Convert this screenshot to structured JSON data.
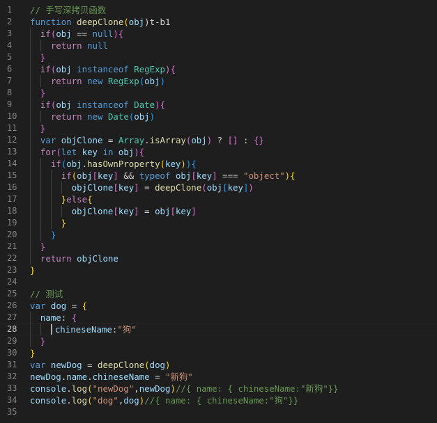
{
  "editor": {
    "language": "javascript",
    "theme_colors": {
      "background": "#1e1e1e",
      "line_number": "#858585",
      "comment": "#6a9955",
      "keyword": "#569cd6",
      "control": "#c586c0",
      "function": "#dcdcaa",
      "string": "#ce9178",
      "bracket_gold": "#ffd700",
      "bracket_orchid": "#da70d6",
      "bracket_blue": "#179fff"
    },
    "active_line": 28,
    "lines": [
      {
        "n": "1",
        "indent": 0,
        "tokens": [
          [
            "// 手写深拷贝函数",
            "t-comment"
          ]
        ]
      },
      {
        "n": "2",
        "indent": 0,
        "tokens": [
          [
            "function",
            "t-kw"
          ],
          [
            " ",
            "t-punc"
          ],
          [
            "deepClone",
            "t-fn"
          ],
          [
            "(",
            "t-b1"
          ],
          [
            "obj",
            "t-var"
          ],
          ")",
          "t-b1"
        ]
      },
      {
        "n": "3",
        "indent": 1,
        "tokens": [
          [
            "if",
            "t-ctrl"
          ],
          [
            "(",
            "t-b2"
          ],
          [
            "obj",
            "t-var"
          ],
          [
            " == ",
            "t-punc"
          ],
          [
            "null",
            "t-kw"
          ],
          [
            ")",
            "t-b2"
          ],
          [
            "{",
            "t-b2"
          ]
        ]
      },
      {
        "n": "4",
        "indent": 2,
        "tokens": [
          [
            "return",
            "t-ctrl"
          ],
          [
            " ",
            "t-punc"
          ],
          [
            "null",
            "t-kw"
          ]
        ]
      },
      {
        "n": "5",
        "indent": 1,
        "tokens": [
          [
            "}",
            "t-b2"
          ]
        ]
      },
      {
        "n": "6",
        "indent": 1,
        "tokens": [
          [
            "if",
            "t-ctrl"
          ],
          [
            "(",
            "t-b2"
          ],
          [
            "obj",
            "t-var"
          ],
          [
            " ",
            "t-punc"
          ],
          [
            "instanceof",
            "t-kw"
          ],
          [
            " ",
            "t-punc"
          ],
          [
            "RegExp",
            "t-cls"
          ],
          [
            ")",
            "t-b2"
          ],
          [
            "{",
            "t-b2"
          ]
        ]
      },
      {
        "n": "7",
        "indent": 2,
        "tokens": [
          [
            "return",
            "t-ctrl"
          ],
          [
            " ",
            "t-punc"
          ],
          [
            "new",
            "t-kw"
          ],
          [
            " ",
            "t-punc"
          ],
          [
            "RegExp",
            "t-cls"
          ],
          [
            "(",
            "t-b3"
          ],
          [
            "obj",
            "t-var"
          ],
          [
            ")",
            "t-b3"
          ]
        ]
      },
      {
        "n": "8",
        "indent": 1,
        "tokens": [
          [
            "}",
            "t-b2"
          ]
        ]
      },
      {
        "n": "9",
        "indent": 1,
        "tokens": [
          [
            "if",
            "t-ctrl"
          ],
          [
            "(",
            "t-b2"
          ],
          [
            "obj",
            "t-var"
          ],
          [
            " ",
            "t-punc"
          ],
          [
            "instanceof",
            "t-kw"
          ],
          [
            " ",
            "t-punc"
          ],
          [
            "Date",
            "t-cls"
          ],
          [
            ")",
            "t-b2"
          ],
          [
            "{",
            "t-b2"
          ]
        ]
      },
      {
        "n": "10",
        "indent": 2,
        "tokens": [
          [
            "return",
            "t-ctrl"
          ],
          [
            " ",
            "t-punc"
          ],
          [
            "new",
            "t-kw"
          ],
          [
            " ",
            "t-punc"
          ],
          [
            "Date",
            "t-cls"
          ],
          [
            "(",
            "t-b3"
          ],
          [
            "obj",
            "t-var"
          ],
          [
            ")",
            "t-b3"
          ]
        ]
      },
      {
        "n": "11",
        "indent": 1,
        "tokens": [
          [
            "}",
            "t-b2"
          ]
        ]
      },
      {
        "n": "12",
        "indent": 1,
        "tokens": [
          [
            "var",
            "t-kw"
          ],
          [
            " ",
            "t-punc"
          ],
          [
            "objClone",
            "t-var"
          ],
          [
            " = ",
            "t-punc"
          ],
          [
            "Array",
            "t-cls"
          ],
          [
            ".",
            "t-punc"
          ],
          [
            "isArray",
            "t-fn"
          ],
          [
            "(",
            "t-b2"
          ],
          [
            "obj",
            "t-var"
          ],
          [
            ")",
            "t-b2"
          ],
          [
            " ? ",
            "t-punc"
          ],
          [
            "[]",
            "t-b2"
          ],
          [
            " : ",
            "t-punc"
          ],
          [
            "{}",
            "t-b2"
          ]
        ]
      },
      {
        "n": "13",
        "indent": 1,
        "tokens": [
          [
            "for",
            "t-ctrl"
          ],
          [
            "(",
            "t-b2"
          ],
          [
            "let",
            "t-kw"
          ],
          [
            " ",
            "t-punc"
          ],
          [
            "key",
            "t-var"
          ],
          [
            " ",
            "t-punc"
          ],
          [
            "in",
            "t-kw"
          ],
          [
            " ",
            "t-punc"
          ],
          [
            "obj",
            "t-var"
          ],
          [
            ")",
            "t-b2"
          ],
          [
            "{",
            "t-b2"
          ]
        ]
      },
      {
        "n": "14",
        "indent": 2,
        "tokens": [
          [
            "if",
            "t-ctrl"
          ],
          [
            "(",
            "t-b3"
          ],
          [
            "obj",
            "t-var"
          ],
          [
            ".",
            "t-punc"
          ],
          [
            "hasOwnProperty",
            "t-fn"
          ],
          [
            "(",
            "t-b1"
          ],
          [
            "key",
            "t-var"
          ],
          [
            ")",
            "t-b1"
          ],
          [
            ")",
            "t-b3"
          ],
          [
            "{",
            "t-b3"
          ]
        ]
      },
      {
        "n": "15",
        "indent": 3,
        "tokens": [
          [
            "if",
            "t-ctrl"
          ],
          [
            "(",
            "t-b1"
          ],
          [
            "obj",
            "t-var"
          ],
          [
            "[",
            "t-b2"
          ],
          [
            "key",
            "t-var"
          ],
          [
            "]",
            "t-b2"
          ],
          [
            " && ",
            "t-punc"
          ],
          [
            "typeof",
            "t-kw"
          ],
          [
            " ",
            "t-punc"
          ],
          [
            "obj",
            "t-var"
          ],
          [
            "[",
            "t-b2"
          ],
          [
            "key",
            "t-var"
          ],
          [
            "]",
            "t-b2"
          ],
          [
            " === ",
            "t-punc"
          ],
          [
            "\"object\"",
            "t-str"
          ],
          [
            ")",
            "t-b1"
          ],
          [
            "{",
            "t-b1"
          ]
        ]
      },
      {
        "n": "16",
        "indent": 4,
        "tokens": [
          [
            "objClone",
            "t-var"
          ],
          [
            "[",
            "t-b2"
          ],
          [
            "key",
            "t-var"
          ],
          [
            "]",
            "t-b2"
          ],
          [
            " = ",
            "t-punc"
          ],
          [
            "deepClone",
            "t-fn"
          ],
          [
            "(",
            "t-b2"
          ],
          [
            "obj",
            "t-var"
          ],
          [
            "[",
            "t-b3"
          ],
          [
            "key",
            "t-var"
          ],
          [
            "]",
            "t-b3"
          ],
          [
            ")",
            "t-b2"
          ]
        ]
      },
      {
        "n": "17",
        "indent": 3,
        "tokens": [
          [
            "}",
            "t-b1"
          ],
          [
            "else",
            "t-ctrl"
          ],
          [
            "{",
            "t-b1"
          ]
        ]
      },
      {
        "n": "18",
        "indent": 4,
        "tokens": [
          [
            "objClone",
            "t-var"
          ],
          [
            "[",
            "t-b2"
          ],
          [
            "key",
            "t-var"
          ],
          [
            "]",
            "t-b2"
          ],
          [
            " = ",
            "t-punc"
          ],
          [
            "obj",
            "t-var"
          ],
          [
            "[",
            "t-b2"
          ],
          [
            "key",
            "t-var"
          ],
          [
            "]",
            "t-b2"
          ]
        ]
      },
      {
        "n": "19",
        "indent": 3,
        "tokens": [
          [
            "}",
            "t-b1"
          ]
        ]
      },
      {
        "n": "20",
        "indent": 2,
        "tokens": [
          [
            "}",
            "t-b3"
          ]
        ]
      },
      {
        "n": "21",
        "indent": 1,
        "tokens": [
          [
            "}",
            "t-b2"
          ]
        ]
      },
      {
        "n": "22",
        "indent": 1,
        "tokens": [
          [
            "return",
            "t-ctrl"
          ],
          [
            " ",
            "t-punc"
          ],
          [
            "objClone",
            "t-var"
          ]
        ]
      },
      {
        "n": "23",
        "indent": 0,
        "tokens": [
          [
            "}",
            "t-b1"
          ]
        ]
      },
      {
        "n": "24",
        "indent": 0,
        "tokens": []
      },
      {
        "n": "25",
        "indent": 0,
        "tokens": [
          [
            "// 测试",
            "t-comment"
          ]
        ]
      },
      {
        "n": "26",
        "indent": 0,
        "tokens": [
          [
            "var",
            "t-kw"
          ],
          [
            " ",
            "t-punc"
          ],
          [
            "dog",
            "t-var"
          ],
          [
            " = ",
            "t-punc"
          ],
          [
            "{",
            "t-b1"
          ]
        ]
      },
      {
        "n": "27",
        "indent": 1,
        "tokens": [
          [
            "name",
            "t-var"
          ],
          [
            ": ",
            "t-punc"
          ],
          [
            "{",
            "t-b2"
          ]
        ]
      },
      {
        "n": "28",
        "indent": 2,
        "tokens": [
          [
            "chineseName",
            "t-var"
          ],
          [
            ":",
            "t-punc"
          ],
          [
            "\"狗\"",
            "t-str"
          ]
        ]
      },
      {
        "n": "29",
        "indent": 1,
        "tokens": [
          [
            "}",
            "t-b2"
          ]
        ]
      },
      {
        "n": "30",
        "indent": 0,
        "tokens": [
          [
            "}",
            "t-b1"
          ]
        ]
      },
      {
        "n": "31",
        "indent": 0,
        "tokens": [
          [
            "var",
            "t-kw"
          ],
          [
            " ",
            "t-punc"
          ],
          [
            "newDog",
            "t-var"
          ],
          [
            " = ",
            "t-punc"
          ],
          [
            "deepClone",
            "t-fn"
          ],
          [
            "(",
            "t-b1"
          ],
          [
            "dog",
            "t-var"
          ],
          [
            ")",
            "t-b1"
          ]
        ]
      },
      {
        "n": "32",
        "indent": 0,
        "tokens": [
          [
            "newDog",
            "t-var"
          ],
          [
            ".",
            "t-punc"
          ],
          [
            "name",
            "t-var"
          ],
          [
            ".",
            "t-punc"
          ],
          [
            "chineseName",
            "t-var"
          ],
          [
            " = ",
            "t-punc"
          ],
          [
            "\"新狗\"",
            "t-str"
          ]
        ]
      },
      {
        "n": "33",
        "indent": 0,
        "tokens": [
          [
            "console",
            "t-var"
          ],
          [
            ".",
            "t-punc"
          ],
          [
            "log",
            "t-fn"
          ],
          [
            "(",
            "t-b1"
          ],
          [
            "\"newDog\"",
            "t-str"
          ],
          [
            ",",
            "t-punc"
          ],
          [
            "newDog",
            "t-var"
          ],
          [
            ")",
            "t-b1"
          ],
          [
            "//{ name: { chineseName:\"新狗\"}}",
            "t-comment"
          ]
        ]
      },
      {
        "n": "34",
        "indent": 0,
        "tokens": [
          [
            "console",
            "t-var"
          ],
          [
            ".",
            "t-punc"
          ],
          [
            "log",
            "t-fn"
          ],
          [
            "(",
            "t-b1"
          ],
          [
            "\"dog\"",
            "t-str"
          ],
          [
            ",",
            "t-punc"
          ],
          [
            "dog",
            "t-var"
          ],
          [
            ")",
            "t-b1"
          ],
          [
            "//{ name: { chineseName:\"狗\"}}",
            "t-comment"
          ]
        ]
      },
      {
        "n": "35",
        "indent": 0,
        "tokens": []
      }
    ]
  }
}
